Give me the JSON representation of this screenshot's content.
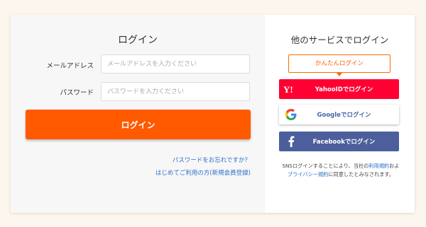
{
  "login": {
    "title": "ログイン",
    "email_label": "メールアドレス",
    "email_placeholder": "メールアドレスを入力ください",
    "password_label": "パスワード",
    "password_placeholder": "パスワードを入力ください",
    "login_button": "ログイン",
    "forgot_link": "パスワードをお忘れですか？",
    "register_link": "はじめてご利用の方(新規会員登録)"
  },
  "sns": {
    "title": "他のサービスでログイン",
    "easy_label": "かんたんログイン",
    "yahoo_label": "YahooIDでログイン",
    "google_label": "Googleでログイン",
    "facebook_label": "Facebookでログイン",
    "note_prefix": "SNSログインすることにより、当社の",
    "terms_link": "利用規約",
    "note_middle": "およ",
    "privacy_link": "プライバシー規約",
    "note_suffix": "に同意したとみなされます。"
  },
  "colors": {
    "accent": "#ff5a00",
    "yahoo": "#ff0033",
    "facebook": "#4c5f9c",
    "link": "#2a6fc9"
  },
  "icons": {
    "yahoo": "yahoo-logo-icon",
    "google": "google-logo-icon",
    "facebook": "facebook-logo-icon"
  }
}
